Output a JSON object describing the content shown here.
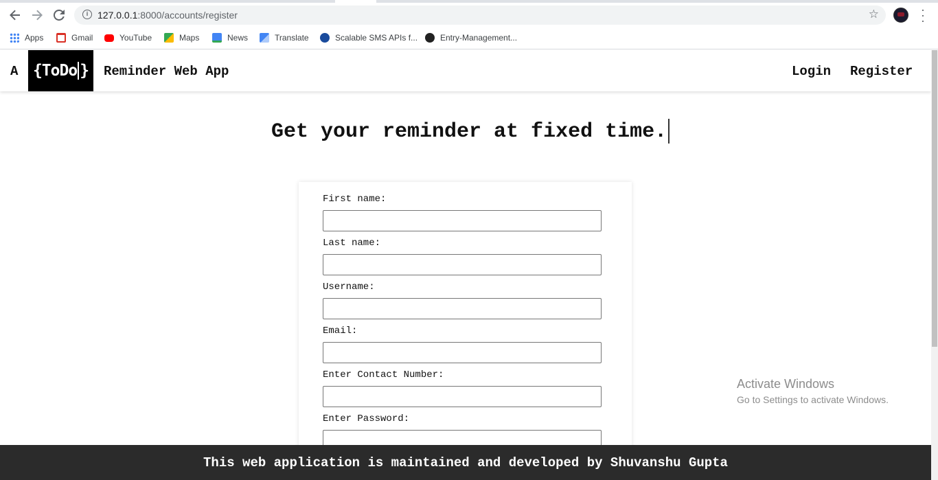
{
  "browser": {
    "url_host": "127.0.0.1",
    "url_path": ":8000/accounts/register",
    "bookmarks": [
      {
        "label": "Apps",
        "icon": "apps-grid-icon",
        "color": "#4285f4"
      },
      {
        "label": "Gmail",
        "icon": "gmail-icon",
        "color": "#d93025"
      },
      {
        "label": "YouTube",
        "icon": "youtube-icon",
        "color": "#ff0000"
      },
      {
        "label": "Maps",
        "icon": "maps-icon",
        "color": "#34a853"
      },
      {
        "label": "News",
        "icon": "news-icon",
        "color": "#4285f4"
      },
      {
        "label": "Translate",
        "icon": "translate-icon",
        "color": "#4285f4"
      },
      {
        "label": "Scalable SMS APIs f...",
        "icon": "sms-icon",
        "color": "#1a4b9c"
      },
      {
        "label": "Entry-Management...",
        "icon": "github-icon",
        "color": "#222222"
      }
    ]
  },
  "nav": {
    "brand_prefix": "A",
    "brand_logo": "{ToDo}",
    "brand_logo_left": "{ToDo",
    "brand_logo_right": "}",
    "brand_suffix": "Reminder Web App",
    "login": "Login",
    "register": "Register"
  },
  "headline": "Get your reminder at fixed time.",
  "form": {
    "fields": [
      {
        "label": "First name:",
        "value": ""
      },
      {
        "label": "Last name:",
        "value": ""
      },
      {
        "label": "Username:",
        "value": ""
      },
      {
        "label": "Email:",
        "value": ""
      },
      {
        "label": "Enter Contact Number:",
        "value": ""
      },
      {
        "label": "Enter Password:",
        "value": ""
      }
    ]
  },
  "footer": "This web application is maintained and developed by Shuvanshu Gupta",
  "watermark": {
    "line1": "Activate Windows",
    "line2": "Go to Settings to activate Windows."
  }
}
